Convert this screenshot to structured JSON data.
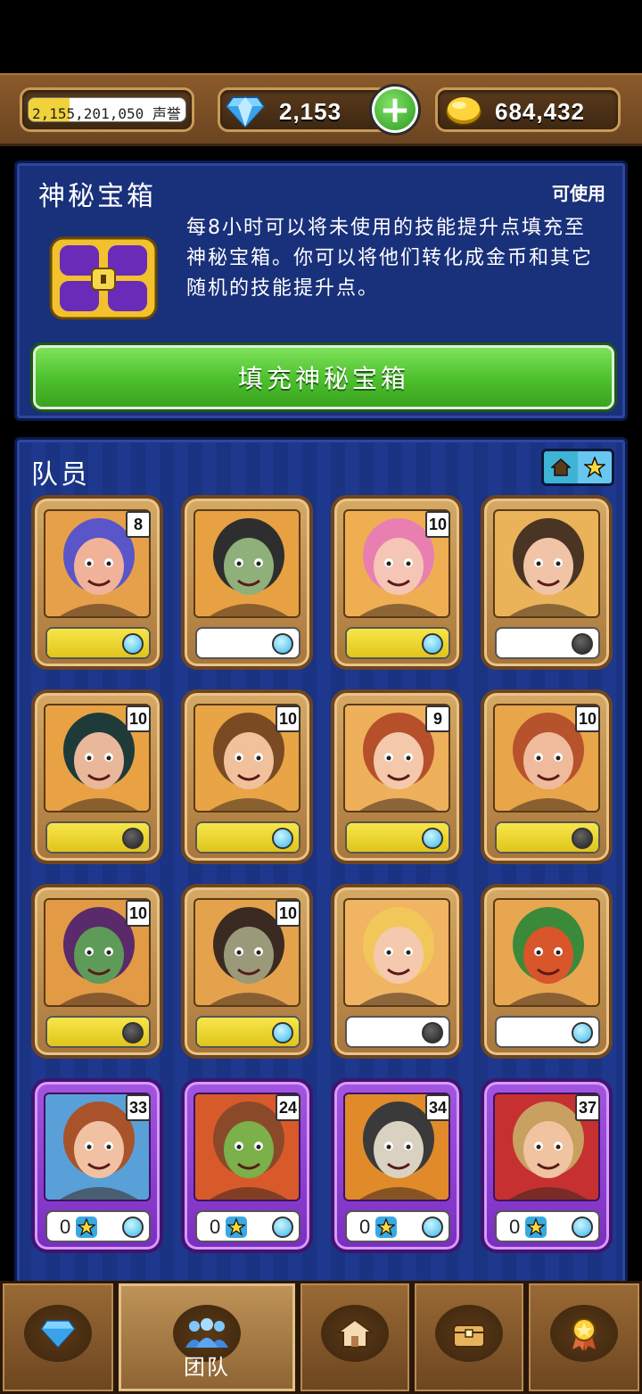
{
  "currency": {
    "reputation_value": "2,155,201,050",
    "reputation_label": "声誉",
    "reputation_progress": 0.26,
    "gems": "2,153",
    "gold": "684,432"
  },
  "mystery_chest": {
    "title": "神秘宝箱",
    "status": "可使用",
    "description": "每8小时可以将未使用的技能提升点填充至神秘宝箱。你可以将他们转化成金币和其它随机的技能提升点。",
    "fill_button": "填充神秘宝箱"
  },
  "team": {
    "title": "队员",
    "members": [
      {
        "level": "8",
        "bar": 1.0,
        "dot": "on",
        "frame": "gold",
        "bg": "#e7a04a",
        "skin": "#f0b39a",
        "hair": "#5a55c8"
      },
      {
        "level": "",
        "bar": 0.0,
        "dot": "on",
        "frame": "gold",
        "bg": "#e8a142",
        "skin": "#8fb07a",
        "hair": "#2e2e2e"
      },
      {
        "level": "10",
        "bar": 1.0,
        "dot": "on",
        "frame": "gold",
        "bg": "#efae52",
        "skin": "#f5c6b5",
        "hair": "#e97fb0"
      },
      {
        "level": "",
        "bar": 0.0,
        "dot": "off",
        "frame": "gold",
        "bg": "#eab35a",
        "skin": "#f1c4a8",
        "hair": "#4a3424"
      },
      {
        "level": "10",
        "bar": 1.0,
        "dot": "off",
        "frame": "gold",
        "bg": "#e8a244",
        "skin": "#e9b89a",
        "hair": "#1e3b3a"
      },
      {
        "level": "10",
        "bar": 1.0,
        "dot": "on",
        "frame": "gold",
        "bg": "#e8a445",
        "skin": "#f1c19c",
        "hair": "#7a4a22"
      },
      {
        "level": "9",
        "bar": 1.0,
        "dot": "on",
        "frame": "gold",
        "bg": "#eeb05a",
        "skin": "#f4c8aa",
        "hair": "#b5502a"
      },
      {
        "level": "10",
        "bar": 1.0,
        "dot": "off",
        "frame": "gold",
        "bg": "#e9a54a",
        "skin": "#f0bb9c",
        "hair": "#b6522c"
      },
      {
        "level": "10",
        "bar": 1.0,
        "dot": "off",
        "frame": "gold",
        "bg": "#e29a45",
        "skin": "#5e9a58",
        "hair": "#5a2a6a"
      },
      {
        "level": "10",
        "bar": 1.0,
        "dot": "on",
        "frame": "gold",
        "bg": "#e5a24c",
        "skin": "#9a9a7a",
        "hair": "#3a2a22"
      },
      {
        "level": "",
        "bar": 0.0,
        "dot": "off",
        "frame": "gold",
        "bg": "#f0b463",
        "skin": "#f4c9ad",
        "hair": "#f2c75a"
      },
      {
        "level": "",
        "bar": 0.0,
        "dot": "on",
        "frame": "gold",
        "bg": "#e9a650",
        "skin": "#d9552a",
        "hair": "#3a8a3a"
      },
      {
        "level": "33",
        "rank": "0",
        "dot": "on",
        "frame": "purple",
        "bg": "#5aa0d8",
        "skin": "#f1c1a3",
        "hair": "#a8532a"
      },
      {
        "level": "24",
        "rank": "0",
        "dot": "on",
        "frame": "purple",
        "bg": "#d85a2a",
        "skin": "#7bb04a",
        "hair": "#8a4a2a"
      },
      {
        "level": "34",
        "rank": "0",
        "dot": "on",
        "frame": "purple",
        "bg": "#e08a2a",
        "skin": "#d9d2c2",
        "hair": "#3a3a3a"
      },
      {
        "level": "37",
        "rank": "0",
        "dot": "on",
        "frame": "purple",
        "bg": "#c63030",
        "skin": "#f0c4a0",
        "hair": "#c8a060"
      }
    ]
  },
  "nav": {
    "tabs": [
      {
        "name": "gems",
        "label": ""
      },
      {
        "name": "team",
        "label": "团队"
      },
      {
        "name": "town",
        "label": ""
      },
      {
        "name": "chest",
        "label": ""
      },
      {
        "name": "awards",
        "label": ""
      }
    ]
  },
  "colors": {
    "panel": "#19307a",
    "button_green": "#4bbf2c",
    "wood": "#8b5a2b",
    "purple_frame": "#8a3ad0"
  }
}
